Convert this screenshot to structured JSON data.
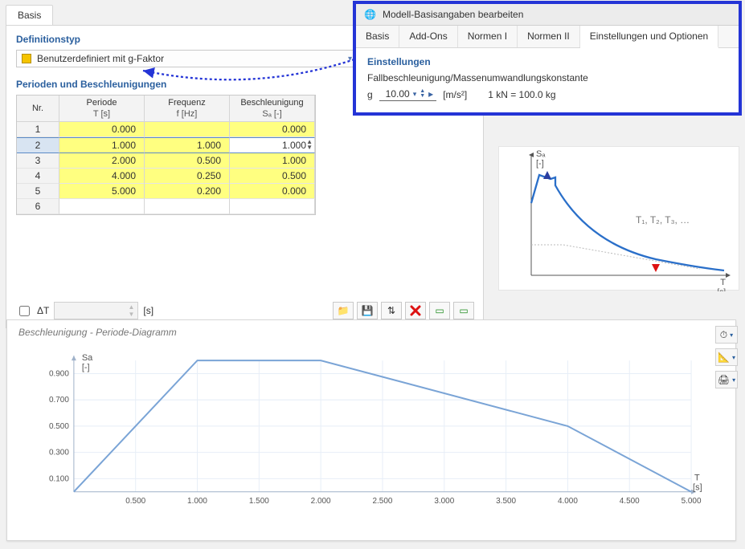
{
  "tabs": {
    "basis": "Basis"
  },
  "definition": {
    "title": "Definitionstyp",
    "option": "Benutzerdefiniert mit g-Faktor"
  },
  "table": {
    "title": "Perioden und Beschleunigungen",
    "headers": {
      "nr": "Nr.",
      "period_top": "Periode",
      "period_sub": "T [s]",
      "freq_top": "Frequenz",
      "freq_sub": "f [Hz]",
      "acc_top": "Beschleunigung",
      "acc_sub": "Sₐ [-]"
    },
    "rows": [
      {
        "nr": "1",
        "T": "0.000",
        "f": "",
        "Sa": "0.000"
      },
      {
        "nr": "2",
        "T": "1.000",
        "f": "1.000",
        "Sa": "1.000"
      },
      {
        "nr": "3",
        "T": "2.000",
        "f": "0.500",
        "Sa": "1.000"
      },
      {
        "nr": "4",
        "T": "4.000",
        "f": "0.250",
        "Sa": "0.500"
      },
      {
        "nr": "5",
        "T": "5.000",
        "f": "0.200",
        "Sa": "0.000"
      },
      {
        "nr": "6",
        "T": "",
        "f": "",
        "Sa": ""
      }
    ]
  },
  "toolbar": {
    "dt_label": "ΔT",
    "dt_unit": "[s]",
    "spinner": "▲▼"
  },
  "dialog": {
    "title": "Modell-Basisangaben bearbeiten",
    "tabs": {
      "basis": "Basis",
      "addons": "Add-Ons",
      "norm1": "Normen I",
      "norm2": "Normen II",
      "settings": "Einstellungen und Optionen"
    },
    "section": "Einstellungen",
    "subtitle": "Fallbeschleunigung/Massenumwandlungskonstante",
    "g_label": "g",
    "g_value": "10.00",
    "g_unit": "[m/s²]",
    "conv": "1 kN = 100.0 kg"
  },
  "schematic": {
    "y_label": "Sₐ",
    "y_unit": "[-]",
    "x_label": "T",
    "x_unit": "[s]",
    "annot": "T₁, T₂, T₃, …"
  },
  "chart": {
    "card_title": "Beschleunigung - Periode-Diagramm"
  },
  "chart_data": {
    "type": "line",
    "title": "Beschleunigung - Periode-Diagramm",
    "xlabel": "T [s]",
    "ylabel": "Sa [-]",
    "xlim": [
      0,
      5.0
    ],
    "ylim": [
      0,
      1.0
    ],
    "xticks": [
      0.5,
      1.0,
      1.5,
      2.0,
      2.5,
      3.0,
      3.5,
      4.0,
      4.5,
      5.0
    ],
    "yticks": [
      0.1,
      0.3,
      0.5,
      0.7,
      0.9
    ],
    "series": [
      {
        "name": "Sa",
        "x": [
          0.0,
          1.0,
          2.0,
          4.0,
          5.0
        ],
        "y": [
          0.0,
          1.0,
          1.0,
          0.5,
          0.0
        ]
      }
    ]
  }
}
